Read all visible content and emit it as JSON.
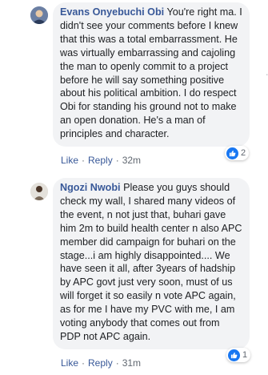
{
  "comments": [
    {
      "author": "Evans Onyebuchi Obi",
      "text": "You're right ma. I didn't see your comments before I knew that this was a total embarrassment. He was virtually embarrassing and cajoling the man to openly commit to a project before he will say something positive about his political ambition. I do respect Obi for standing his ground not to make an open donation. He's a man of principles and character.",
      "reaction_count": "2",
      "like_label": "Like",
      "reply_label": "Reply",
      "separator": "·",
      "time": "32m"
    },
    {
      "author": "Ngozi Nwobi",
      "text": "Please you guys should check my wall, I shared many videos of the event, n not just that, buhari gave him 2m to build health center n also APC member did campaign for buhari on the stage...i am highly disappointed.... We have seen it all, after 3years of hadship by APC govt just very soon, must of us will forget it so easily n vote APC again, as for me I have my PVC with me, I am voting anybody that comes out from PDP not APC again.",
      "reaction_count": "1",
      "like_label": "Like",
      "reply_label": "Reply",
      "separator": "·",
      "time": "31m"
    }
  ],
  "colors": {
    "author": "#385898",
    "bubble": "#f2f3f5",
    "like_badge": "#1877f2",
    "meta": "#606770"
  }
}
